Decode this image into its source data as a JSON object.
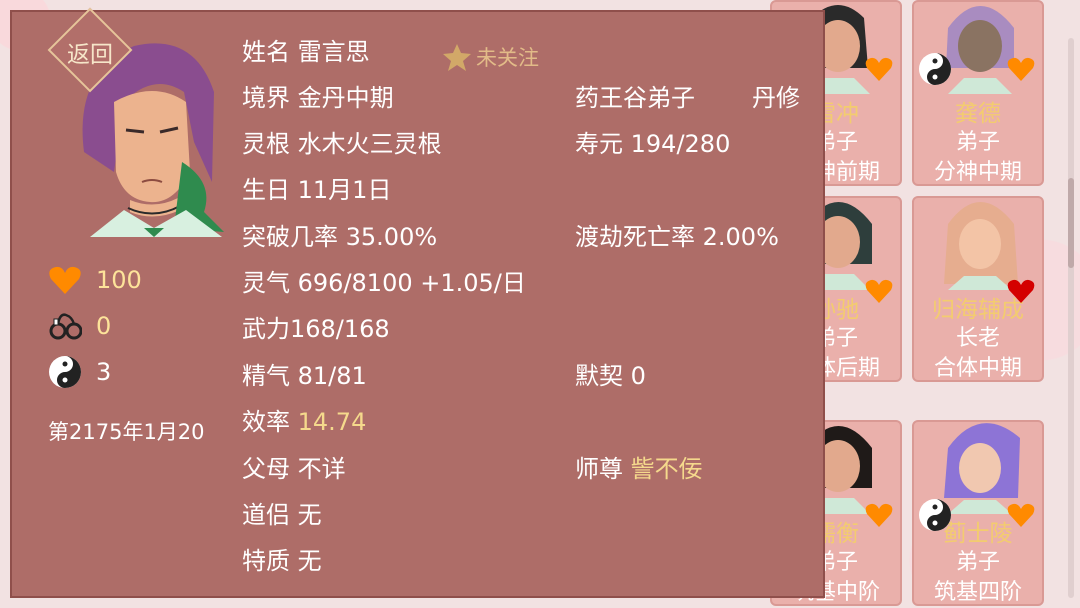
{
  "profile": {
    "back_label": "返回",
    "name_label": "姓名",
    "name": "雷言思",
    "follow_label": "未关注",
    "realm_label": "境界",
    "realm": "金丹中期",
    "sect": "药王谷弟子",
    "role": "丹修",
    "root_label": "灵根",
    "root": "水木火三灵根",
    "lifespan_label": "寿元",
    "lifespan": "194/280",
    "birthday_label": "生日",
    "birthday": "11月1日",
    "breakthrough_label": "突破几率",
    "breakthrough": "35.00%",
    "tribulation_label": "渡劫死亡率",
    "tribulation": "2.00%",
    "qi_label": "灵气",
    "qi": "696/8100 +1.05/日",
    "force_label": "武力",
    "force": "168/168",
    "essence_label": "精气",
    "essence": "81/81",
    "tacit_label": "默契",
    "tacit": "0",
    "efficiency_label": "效率",
    "efficiency": "14.74",
    "parents_label": "父母",
    "parents": "不详",
    "master_label": "师尊",
    "master": "訾不佞",
    "partner_label": "道侣",
    "partner": "无",
    "trait_label": "特质",
    "trait": "无"
  },
  "stats": {
    "affection": "100",
    "affection_color": "#fde39a",
    "bond": "0",
    "bond_color": "#fde39a",
    "yinyang": "3",
    "date": "第2175年1月20"
  },
  "cards": [
    {
      "name": "雷冲",
      "role": "弟子",
      "rank": "分神前期"
    },
    {
      "name": "龚德",
      "role": "弟子",
      "rank": "分神中期"
    },
    {
      "name": "孙驰",
      "role": "弟子",
      "rank": "合体后期"
    },
    {
      "name": "归海辅成",
      "role": "长老",
      "rank": "合体中期"
    },
    {
      "name": "儒衡",
      "role": "弟子",
      "rank": "筑基中阶"
    },
    {
      "name": "蓟士陵",
      "role": "弟子",
      "rank": "筑基四阶"
    }
  ],
  "colors": {
    "panel": "#ae6d68",
    "gold": "#f5d98c",
    "heart_orange": "#ff8a00",
    "heart_red": "#d40000"
  }
}
